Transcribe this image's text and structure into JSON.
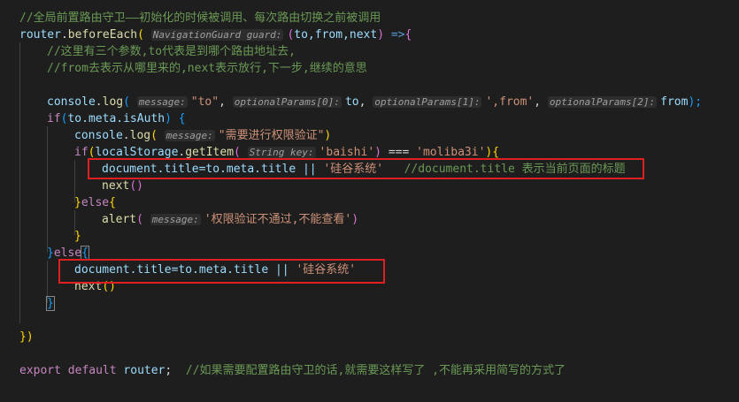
{
  "code": {
    "l1_comment": "//全局前置路由守卫——初始化的时候被调用、每次路由切换之前被调用",
    "l2_router": "router",
    "l2_dot": ".",
    "l2_method": "beforeEach",
    "l2_paren": "(",
    "l2_hint": "NavigationGuard guard:",
    "l2_args_open": "(",
    "l2_args": "to,from,next",
    "l2_args_close": ")",
    "l2_arrow": " =>",
    "l2_brace": "{",
    "l3_comment": "//这里有三个参数,to代表是到哪个路由地址去,",
    "l4_comment": "//from去表示从哪里来的,next表示放行,下一步,继续的意思",
    "l6_console": "console",
    "l6_dot": ".",
    "l6_log": "log",
    "l6_paren": "(",
    "l6_hint1": "message:",
    "l6_str1": "\"to\"",
    "l6_comma1": ",",
    "l6_hint2": "optionalParams[0]:",
    "l6_to": "to",
    "l6_comma2": ",",
    "l6_hint3": "optionalParams[1]:",
    "l6_str2": "',from'",
    "l6_comma3": ",",
    "l6_hint4": "optionalParams[2]:",
    "l6_from": "from",
    "l6_close": ");",
    "l7_if": "if",
    "l7_open": "(",
    "l7_expr": "to.meta.isAuth",
    "l7_close": ")",
    "l7_brace": " {",
    "l8_console": "console",
    "l8_dot": ".",
    "l8_log": "log",
    "l8_paren": "(",
    "l8_hint": "message:",
    "l8_str": "\"需要进行权限验证\"",
    "l8_close": ")",
    "l9_if": "if",
    "l9_open": "(",
    "l9_ls": "localStorage",
    "l9_dot": ".",
    "l9_getitem": "getItem",
    "l9_paren": "(",
    "l9_hint": "String key:",
    "l9_key": "'baishi'",
    "l9_pclose": ")",
    "l9_eq": " === ",
    "l9_val": "'moliba3i'",
    "l9_close": ")",
    "l9_brace": "{",
    "l10_code": "document.title=to.meta.title || ",
    "l10_str": "'硅谷系统'",
    "l10_comment": "   //document.title 表示当前页面的标题",
    "l11_next": "next",
    "l11_parens": "()",
    "l12_close": "}",
    "l12_else": "else",
    "l12_brace": "{",
    "l13_alert": "alert",
    "l13_paren": "(",
    "l13_hint": "message:",
    "l13_str": "'权限验证不通过,不能查看'",
    "l13_close": ")",
    "l14_close": "}",
    "l15_close": "}",
    "l15_else": "else",
    "l15_brace": "{",
    "l16_code": "document.title=to.meta.title || ",
    "l16_str": "'硅谷系统'",
    "l17_next": "next",
    "l17_parens": "()",
    "l18_close": "}",
    "l20_close": "})",
    "l22_export": "export",
    "l22_default": " default ",
    "l22_router": "router",
    "l22_semi": ";",
    "l22_comment": "  //如果需要配置路由守卫的话,就需要这样写了 ,不能再采用简写的方式了"
  }
}
